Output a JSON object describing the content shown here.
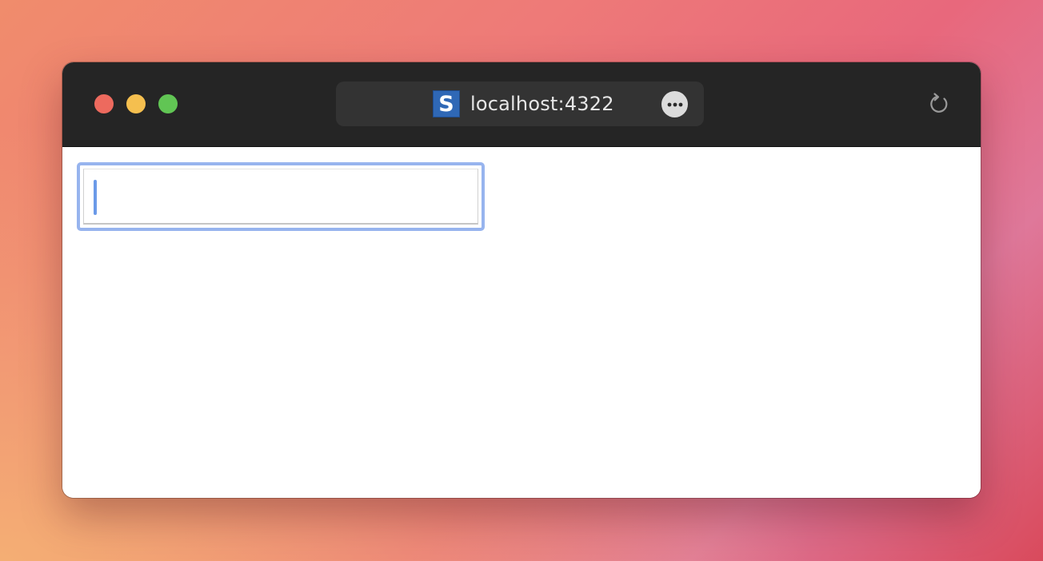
{
  "browser": {
    "url": "localhost:4322",
    "favicon_letter": "S",
    "favicon_color": "#2f68b6",
    "traffic_lights": {
      "close_color": "#ed6a5e",
      "minimize_color": "#f5bf4f",
      "maximize_color": "#61c554"
    },
    "icons": {
      "more": "ellipsis-icon",
      "reload": "reload-icon"
    }
  },
  "page": {
    "text_input": {
      "value": "",
      "placeholder": "",
      "focused": true,
      "focus_ring_color": "#97b4ee"
    }
  }
}
